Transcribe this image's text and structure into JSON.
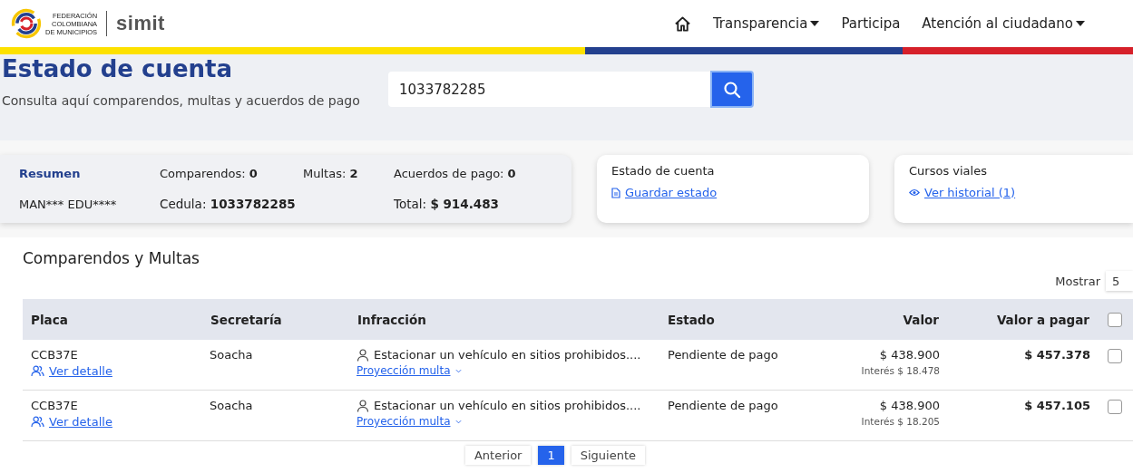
{
  "header": {
    "logo_lines": [
      "FEDERACIÓN",
      "COLOMBIANA",
      "DE MUNICIPIOS"
    ],
    "brand": "simit",
    "nav": [
      {
        "kind": "home"
      },
      {
        "kind": "dropdown",
        "label": "Transparencia"
      },
      {
        "kind": "link",
        "label": "Participa"
      },
      {
        "kind": "dropdown",
        "label": "Atención al ciudadano"
      }
    ]
  },
  "page": {
    "title": "Estado de cuenta",
    "subtitle": "Consulta aquí comparendos, multas y acuerdos de pago",
    "search_value": "1033782285"
  },
  "summary": {
    "heading": "Resumen",
    "name": "MAN*** EDU****",
    "comparendos": "Comparendos: **0**",
    "multas": "Multas: **2**",
    "acuerdos": "Acuerdos de pago: **0**",
    "cedula": "Cedula: **1033782285**",
    "total": "Total: **$ 914.483**"
  },
  "cards": [
    {
      "kind": "document",
      "title": "Estado de cuenta",
      "link": "Guardar estado"
    },
    {
      "kind": "eye",
      "title": "Cursos viales",
      "link": "Ver historial (1)"
    }
  ],
  "table": {
    "title": "Comparendos y Multas",
    "show_label": "Mostrar",
    "show_value": "5",
    "columns": [
      "Placa",
      "Secretaría",
      "Infracción",
      "Estado",
      "Valor",
      "Valor a pagar"
    ],
    "all_checked": false,
    "rows": [
      {
        "plate": "CCB37E",
        "detail_link": "Ver detalle",
        "office": "Soacha",
        "infraction": "Estacionar un vehículo en sitios prohibidos....",
        "projection_link": "Proyección multa",
        "status": "Pendiente de pago",
        "value": "$ 438.900",
        "interest": "Interés $ 18.478",
        "to_pay": "$ 457.378",
        "checked": false
      },
      {
        "plate": "CCB37E",
        "detail_link": "Ver detalle",
        "office": "Soacha",
        "infraction": "Estacionar un vehículo en sitios prohibidos....",
        "projection_link": "Proyección multa",
        "status": "Pendiente de pago",
        "value": "$ 438.900",
        "interest": "Interés $ 18.205",
        "to_pay": "$ 457.105",
        "checked": false
      }
    ]
  },
  "pagination": [
    {
      "label": "Anterior",
      "selected": false
    },
    {
      "label": "1",
      "selected": true
    },
    {
      "label": "Siguiente",
      "selected": false
    }
  ]
}
